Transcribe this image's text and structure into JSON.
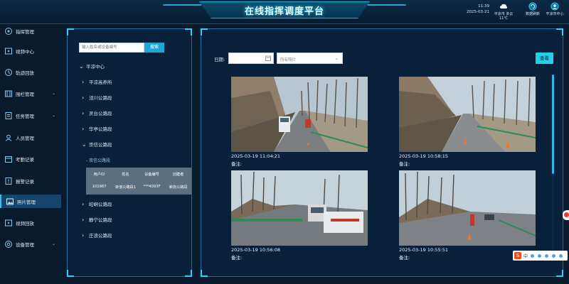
{
  "header": {
    "title": "在线指挥调度平台",
    "time": "11:39",
    "date": "2025-03-21",
    "weather_label": "平凉市 多云 11℃",
    "refresh_label": "数据刷新",
    "user_label": "平凉市中心"
  },
  "sidebar": {
    "items": [
      {
        "label": "指挥管理",
        "icon": "command-icon"
      },
      {
        "label": "视频中心",
        "icon": "video-icon"
      },
      {
        "label": "轨迹回放",
        "icon": "track-icon"
      },
      {
        "label": "围栏管理",
        "icon": "fence-icon",
        "has_children": true
      },
      {
        "label": "任务管理",
        "icon": "task-icon",
        "has_children": true
      },
      {
        "label": "人员管理",
        "icon": "user-icon"
      },
      {
        "label": "考勤记录",
        "icon": "attendance-icon"
      },
      {
        "label": "报警记录",
        "icon": "alarm-icon"
      },
      {
        "label": "照片管理",
        "icon": "photo-icon",
        "active": true
      },
      {
        "label": "视频回放",
        "icon": "playback-icon"
      },
      {
        "label": "设备管理",
        "icon": "device-icon",
        "has_children": true
      }
    ]
  },
  "tree": {
    "search_placeholder": "输入姓名或设备编号",
    "search_button": "搜索",
    "root": "平凉中心",
    "nodes": [
      "平凉高养所",
      "泾川公路段",
      "灵台公路段",
      "华亭公路段",
      "崇信公路段",
      "崆峒公路段",
      "静宁公路段",
      "庄浪公路段"
    ],
    "leaf": "崇信公路段",
    "table_header": [
      "用户ID",
      "姓名",
      "设备编号",
      "创建者"
    ],
    "table_row": [
      "101987",
      "崇信公路段1",
      "***4093F",
      "崇信公路段"
    ]
  },
  "main": {
    "date_label": "日期:",
    "date_value": "",
    "select_placeholder": "所有照片",
    "query_button": "查看",
    "photos": [
      {
        "time": "2025-03-19 11:04:21",
        "note": "备注:"
      },
      {
        "time": "2025-03-19 10:58:15",
        "note": "备注:"
      },
      {
        "time": "2025-03-19 10:56:08",
        "note": "备注:"
      },
      {
        "time": "2025-03-19 10:55:51",
        "note": "备注:"
      }
    ]
  },
  "ime": {
    "label": "中"
  },
  "colors": {
    "accent": "#24d0e8",
    "background": "#071a2e",
    "panel_border": "#1d6d9a"
  }
}
